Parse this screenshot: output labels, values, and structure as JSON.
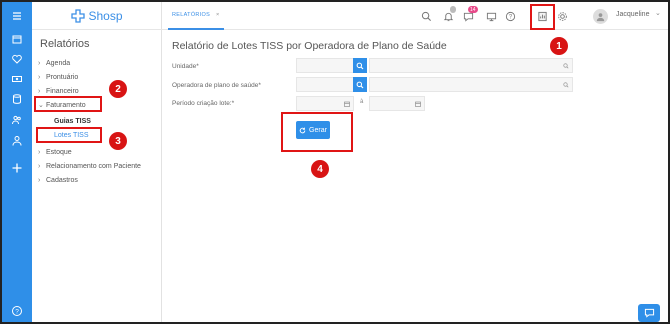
{
  "app": {
    "logo_text": "Shosp"
  },
  "header": {
    "tab_label": "RELATÓRIOS",
    "tab_close": "×",
    "notification_count": "",
    "message_count": "14",
    "user_name": "Jacqueline",
    "user_caret": "⌄"
  },
  "sidebar": {
    "title": "Relatórios",
    "items": [
      {
        "label": "Agenda"
      },
      {
        "label": "Prontuário"
      },
      {
        "label": "Financeiro"
      },
      {
        "label": "Faturamento"
      },
      {
        "label": "Estoque"
      },
      {
        "label": "Relacionamento com Paciente"
      },
      {
        "label": "Cadastros"
      }
    ],
    "subitems": [
      {
        "label": "Guias TISS"
      },
      {
        "label": "Lotes TISS"
      }
    ],
    "chev_closed": "›",
    "chev_open": "⌄"
  },
  "main": {
    "title": "Relatório de Lotes TISS por Operadora de Plano de Saúde",
    "fields": {
      "unidade_label": "Unidade*",
      "operadora_label": "Operadora de plano de saúde*",
      "periodo_label": "Período criação lote:*",
      "periodo_sep": "à"
    },
    "gerar_label": "Gerar"
  },
  "annotations": [
    "1",
    "2",
    "3",
    "4"
  ],
  "colors": {
    "accent": "#2f8fe8",
    "annotation": "#e01515"
  }
}
